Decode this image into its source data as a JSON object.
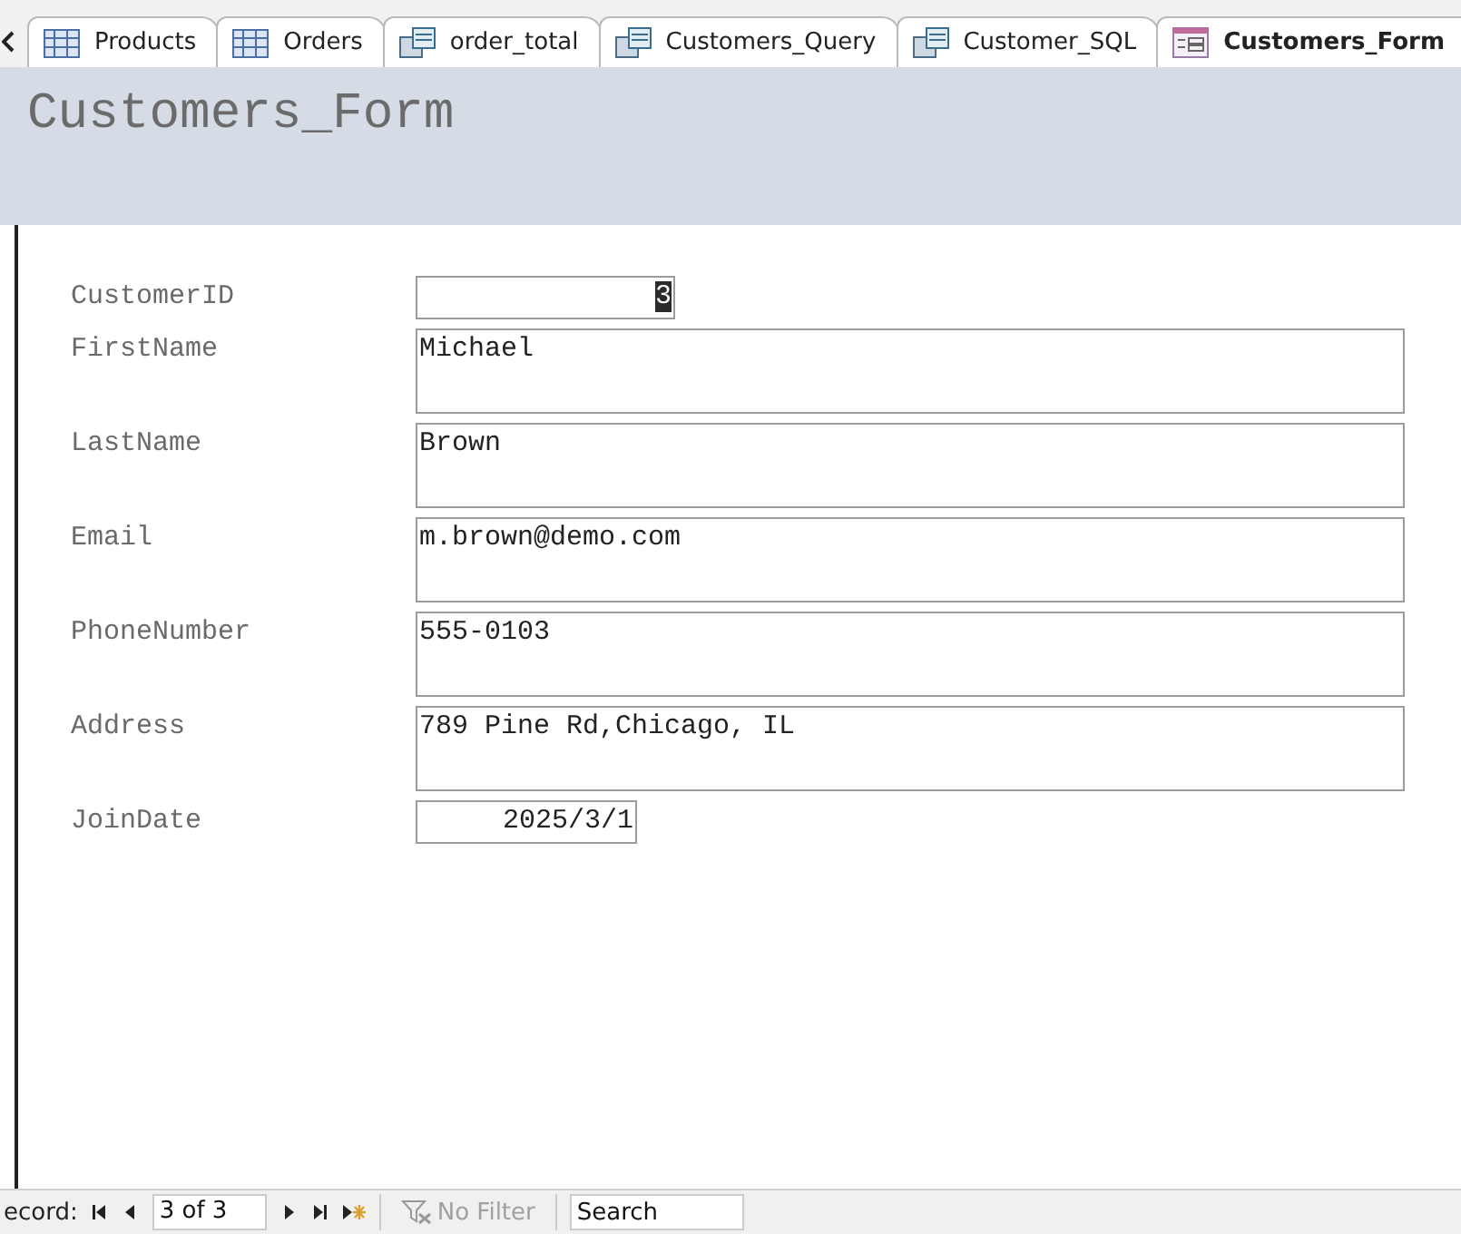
{
  "tabs": [
    {
      "label": "Products",
      "kind": "table",
      "selected": false
    },
    {
      "label": "Orders",
      "kind": "table",
      "selected": false
    },
    {
      "label": "order_total",
      "kind": "query",
      "selected": false
    },
    {
      "label": "Customers_Query",
      "kind": "query",
      "selected": false
    },
    {
      "label": "Customer_SQL",
      "kind": "query",
      "selected": false
    },
    {
      "label": "Customers_Form",
      "kind": "form",
      "selected": true
    }
  ],
  "form": {
    "title": "Customers_Form",
    "fields": [
      {
        "label": "CustomerID",
        "value": "3",
        "kind": "number",
        "highlighted": true
      },
      {
        "label": "FirstName",
        "value": "Michael",
        "kind": "text",
        "highlighted": false
      },
      {
        "label": "LastName",
        "value": "Brown",
        "kind": "text",
        "highlighted": false
      },
      {
        "label": "Email",
        "value": "m.brown@demo.com",
        "kind": "text",
        "highlighted": false
      },
      {
        "label": "PhoneNumber",
        "value": "555-0103",
        "kind": "text",
        "highlighted": false
      },
      {
        "label": "Address",
        "value": "789 Pine Rd,Chicago, IL",
        "kind": "text",
        "highlighted": false
      },
      {
        "label": "JoinDate",
        "value": "2025/3/1",
        "kind": "date",
        "highlighted": false
      }
    ]
  },
  "navigation": {
    "label": "ecord:",
    "position": "3 of 3",
    "filter": "No Filter",
    "filter_disabled": true,
    "search_placeholder": "Search"
  }
}
